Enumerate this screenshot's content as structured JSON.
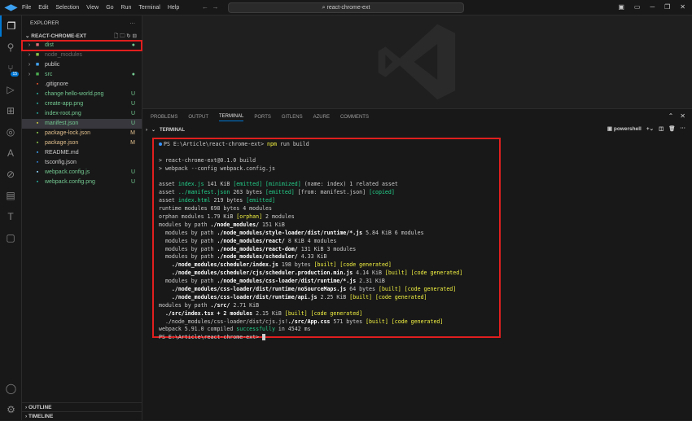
{
  "titlebar": {
    "menu": [
      "File",
      "Edit",
      "Selection",
      "View",
      "Go",
      "Run",
      "Terminal",
      "Help"
    ],
    "search": "react-chrome-ext"
  },
  "activity": {
    "scm_badge": "15"
  },
  "explorer": {
    "title": "EXPLORER",
    "project": "REACT-CHROME-EXT",
    "items": [
      {
        "name": "dist",
        "type": "folder",
        "icon_color": "#e06c75",
        "color": "#73c991",
        "status": "●"
      },
      {
        "name": "node_modules",
        "type": "folder",
        "icon_color": "#8bc34a",
        "color": "#6b6b6b",
        "status": ""
      },
      {
        "name": "public",
        "type": "folder",
        "icon_color": "#42a5f5",
        "color": "#ccc",
        "status": ""
      },
      {
        "name": "src",
        "type": "folder",
        "icon_color": "#4caf50",
        "color": "#73c991",
        "status": "●"
      },
      {
        "name": ".gitignore",
        "type": "file",
        "icon_color": "#e44d26",
        "color": "#ccc",
        "status": ""
      },
      {
        "name": "change hello-world.png",
        "type": "file",
        "icon_color": "#26a69a",
        "color": "#73c991",
        "status": "U"
      },
      {
        "name": "create-app.png",
        "type": "file",
        "icon_color": "#26a69a",
        "color": "#73c991",
        "status": "U"
      },
      {
        "name": "index-root.png",
        "type": "file",
        "icon_color": "#26a69a",
        "color": "#73c991",
        "status": "U"
      },
      {
        "name": "manifest.json",
        "type": "file",
        "icon_color": "#cbcb41",
        "color": "#73c991",
        "status": "U"
      },
      {
        "name": "package-lock.json",
        "type": "file",
        "icon_color": "#8bc34a",
        "color": "#e2c08d",
        "status": "M"
      },
      {
        "name": "package.json",
        "type": "file",
        "icon_color": "#8bc34a",
        "color": "#e2c08d",
        "status": "M"
      },
      {
        "name": "README.md",
        "type": "file",
        "icon_color": "#42a5f5",
        "color": "#ccc",
        "status": ""
      },
      {
        "name": "tsconfig.json",
        "type": "file",
        "icon_color": "#3178c6",
        "color": "#ccc",
        "status": ""
      },
      {
        "name": "webpack.config.js",
        "type": "file",
        "icon_color": "#8ed6fb",
        "color": "#73c991",
        "status": "U"
      },
      {
        "name": "webpack.config.png",
        "type": "file",
        "icon_color": "#26a69a",
        "color": "#73c991",
        "status": "U"
      }
    ],
    "outline": "OUTLINE",
    "timeline": "TIMELINE"
  },
  "panel": {
    "tabs": [
      "PROBLEMS",
      "OUTPUT",
      "TERMINAL",
      "PORTS",
      "GITLENS",
      "AZURE",
      "COMMENTS"
    ],
    "active_tab": "TERMINAL",
    "section": "TERMINAL",
    "shell": "powershell"
  },
  "terminal": {
    "lines": [
      [
        [
          "PS E:\\Article\\react-chrome-ext> ",
          ""
        ],
        [
          "npm",
          "y"
        ],
        [
          " run build",
          ""
        ]
      ],
      [
        [
          "",
          ""
        ]
      ],
      [
        [
          "> react-chrome-ext@0.1.0 build",
          ""
        ]
      ],
      [
        [
          "> webpack --config webpack.config.js",
          ""
        ]
      ],
      [
        [
          "",
          ""
        ]
      ],
      [
        [
          "asset ",
          ""
        ],
        [
          "index.js",
          "g"
        ],
        [
          " 141 KiB ",
          ""
        ],
        [
          "[emitted]",
          "g"
        ],
        [
          " ",
          ""
        ],
        [
          "[minimized]",
          "g"
        ],
        [
          " (name: index) 1 related asset",
          ""
        ]
      ],
      [
        [
          "asset ",
          ""
        ],
        [
          "../manifest.json",
          "g"
        ],
        [
          " 263 bytes ",
          ""
        ],
        [
          "[emitted]",
          "g"
        ],
        [
          " [from: manifest.json] ",
          ""
        ],
        [
          "[copied]",
          "g"
        ]
      ],
      [
        [
          "asset ",
          ""
        ],
        [
          "index.html",
          "g"
        ],
        [
          " 219 bytes ",
          ""
        ],
        [
          "[emitted]",
          "g"
        ]
      ],
      [
        [
          "runtime modules 698 bytes 4 modules",
          ""
        ]
      ],
      [
        [
          "orphan modules 1.79 KiB ",
          ""
        ],
        [
          "[orphan]",
          "y"
        ],
        [
          " 2 modules",
          ""
        ]
      ],
      [
        [
          "modules by path ",
          ""
        ],
        [
          "./node_modules/",
          "b"
        ],
        [
          " 151 KiB",
          ""
        ]
      ],
      [
        [
          "  modules by path ",
          ""
        ],
        [
          "./node_modules/style-loader/dist/runtime/*.js",
          "b"
        ],
        [
          " 5.84 KiB 6 modules",
          ""
        ]
      ],
      [
        [
          "  modules by path ",
          ""
        ],
        [
          "./node_modules/react/",
          "b"
        ],
        [
          " 8 KiB 4 modules",
          ""
        ]
      ],
      [
        [
          "  modules by path ",
          ""
        ],
        [
          "./node_modules/react-dom/",
          "b"
        ],
        [
          " 131 KiB 3 modules",
          ""
        ]
      ],
      [
        [
          "  modules by path ",
          ""
        ],
        [
          "./node_modules/scheduler/",
          "b"
        ],
        [
          " 4.33 KiB",
          ""
        ]
      ],
      [
        [
          "    ",
          ""
        ],
        [
          "./node_modules/scheduler/index.js",
          "b"
        ],
        [
          " 198 bytes ",
          ""
        ],
        [
          "[built] [code generated]",
          "y"
        ]
      ],
      [
        [
          "    ",
          ""
        ],
        [
          "./node_modules/scheduler/cjs/scheduler.production.min.js",
          "b"
        ],
        [
          " 4.14 KiB ",
          ""
        ],
        [
          "[built] [code generated]",
          "y"
        ]
      ],
      [
        [
          "  modules by path ",
          ""
        ],
        [
          "./node_modules/css-loader/dist/runtime/*.js",
          "b"
        ],
        [
          " 2.31 KiB",
          ""
        ]
      ],
      [
        [
          "    ",
          ""
        ],
        [
          "./node_modules/css-loader/dist/runtime/noSourceMaps.js",
          "b"
        ],
        [
          " 64 bytes ",
          ""
        ],
        [
          "[built] [code generated]",
          "y"
        ]
      ],
      [
        [
          "    ",
          ""
        ],
        [
          "./node_modules/css-loader/dist/runtime/api.js",
          "b"
        ],
        [
          " 2.25 KiB ",
          ""
        ],
        [
          "[built] [code generated]",
          "y"
        ]
      ],
      [
        [
          "modules by path ",
          ""
        ],
        [
          "./src/",
          "b"
        ],
        [
          " 2.71 KiB",
          ""
        ]
      ],
      [
        [
          "  ",
          ""
        ],
        [
          "./src/index.tsx + 2 modules",
          "b"
        ],
        [
          " 2.15 KiB ",
          ""
        ],
        [
          "[built] [code generated]",
          "y"
        ]
      ],
      [
        [
          "  ./node_modules/css-loader/dist/cjs.js!",
          ""
        ],
        [
          "./src/App.css",
          "b"
        ],
        [
          " 571 bytes ",
          ""
        ],
        [
          "[built] [code generated]",
          "y"
        ]
      ],
      [
        [
          "webpack 5.91.0 compiled ",
          ""
        ],
        [
          "successfully",
          "g"
        ],
        [
          " in 4542 ms",
          ""
        ]
      ],
      [
        [
          "PS E:\\Article\\react-chrome-ext> ",
          ""
        ]
      ]
    ]
  }
}
